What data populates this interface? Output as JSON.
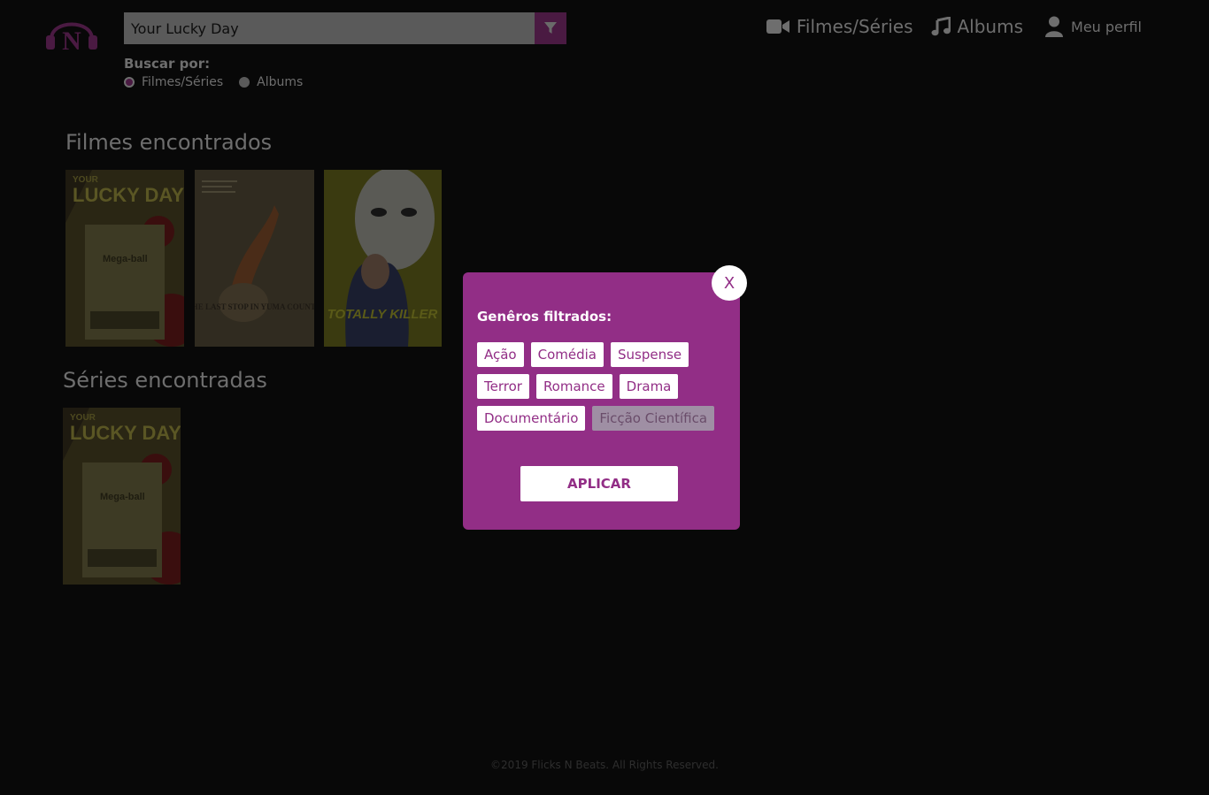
{
  "search": {
    "value": "Your Lucky Day"
  },
  "search_by": {
    "label": "Buscar por:",
    "options": [
      {
        "label": "Filmes/Séries",
        "selected": true
      },
      {
        "label": "Albums",
        "selected": false
      }
    ]
  },
  "nav": {
    "movies": "Filmes/Séries",
    "albums": "Albums",
    "profile": "Meu perfil"
  },
  "movies_section": {
    "title": "Filmes encontrados"
  },
  "series_section": {
    "title": "Séries encontradas"
  },
  "posters": {
    "lucky_top": "YOUR",
    "lucky_main": "LUCKY DAY",
    "lucky_ticket": "Mega-ball",
    "yuma_text": "THE LAST STOP IN YUMA COUNTY",
    "killer_text": "TOTALLY KILLER"
  },
  "modal": {
    "title": "Genêros filtrados:",
    "close": "X",
    "genres_rows": [
      [
        "Ação",
        "Comédia",
        "Suspense"
      ],
      [
        "Terror",
        "Romance",
        "Drama"
      ],
      [
        "Documentário",
        "Ficção Científica"
      ]
    ],
    "selected_genre": "Ficção Científica",
    "apply": "APLICAR"
  },
  "footer": "©2019 Flicks N Beats. All Rights Reserved.",
  "colors": {
    "accent": "#922e86",
    "background": "#080808",
    "selected_chip": "#9f8fa4"
  }
}
